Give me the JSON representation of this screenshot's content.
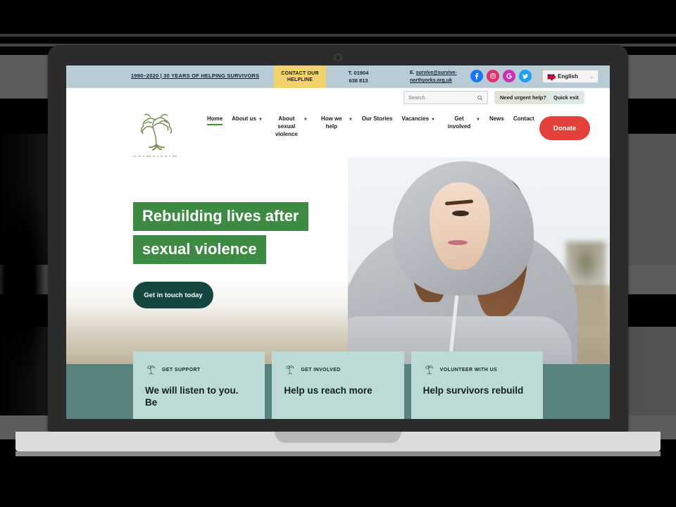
{
  "device": {
    "type": "laptop-mockup"
  },
  "site": {
    "topbar": {
      "tagline": "1990–2020 | 30 YEARS OF HELPING SURVIVORS",
      "helpline_label": "CONTACT OUR HELPLINE",
      "phone_prefix": "T.",
      "phone": "01904 638 813",
      "phone_line1": "T. 01904",
      "phone_line2": "638 813",
      "email_prefix": "E.",
      "email_line1": "survive@survive-",
      "email_line2": "northyorks.org.uk",
      "email": "survive@survive-northyorks.org.uk",
      "socials": [
        {
          "name": "facebook-icon",
          "label": "Facebook",
          "color": "#1877f2"
        },
        {
          "name": "instagram-icon",
          "label": "Instagram",
          "color": "#e1306c"
        },
        {
          "name": "google-icon",
          "label": "Google",
          "color": "#c832b4"
        },
        {
          "name": "twitter-icon",
          "label": "Twitter",
          "color": "#1da1f2"
        }
      ],
      "language": {
        "label": "English",
        "flag": "uk-flag-icon",
        "caret": "⌄"
      },
      "bg_color": "#b9ccd6",
      "flag_color": "#f2d36b"
    },
    "utilrow": {
      "search_placeholder": "Search",
      "search_value": "",
      "search_icon": "search-icon",
      "urgent_label": "Need urgent help?",
      "quick_exit_label": "Quick exit"
    },
    "nav": {
      "logo_word": "SURVIVE",
      "logo_icon": "tree-logo-icon",
      "items": [
        {
          "label": "Home",
          "caret": false,
          "active": true
        },
        {
          "label": "About us",
          "caret": true,
          "active": false
        },
        {
          "label": "About sexual violence",
          "caret": true,
          "active": false
        },
        {
          "label": "How we help",
          "caret": true,
          "active": false
        },
        {
          "label": "Our Stories",
          "caret": false,
          "active": false
        },
        {
          "label": "Vacancies",
          "caret": true,
          "active": false
        },
        {
          "label": "Get involved",
          "caret": true,
          "active": false
        },
        {
          "label": "News",
          "caret": false,
          "active": false
        },
        {
          "label": "Contact",
          "caret": false,
          "active": false
        }
      ],
      "donate_label": "Donate",
      "donate_color": "#e3413b",
      "active_underline_color": "#4a8a3e"
    },
    "hero": {
      "headline_line1": "Rebuilding lives after",
      "headline_line2": "sexual violence",
      "highlight_color": "#3d8b42",
      "cta_label": "Get in touch today",
      "cta_color": "#13473f",
      "image_alt": "Young woman in grey hoodie looking away"
    },
    "cards_section_color": "#58837e",
    "cards": [
      {
        "icon": "tree-icon",
        "eyebrow": "GET SUPPORT",
        "title": "We will listen to you. Be",
        "bg": "#bcdbd6"
      },
      {
        "icon": "tree-icon",
        "eyebrow": "GET INVOLVED",
        "title": "Help us reach more",
        "bg": "#bcdbd6"
      },
      {
        "icon": "tree-icon",
        "eyebrow": "VOLUNTEER WITH US",
        "title": "Help survivors rebuild",
        "bg": "#bcdbd6"
      }
    ]
  }
}
